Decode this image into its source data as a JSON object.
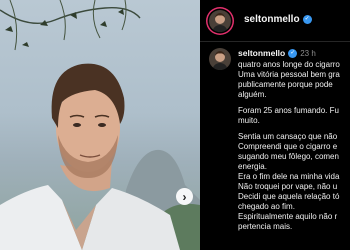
{
  "post": {
    "carousel_next_icon": "chevron-right-icon",
    "username": "seltonmello",
    "verified_icon": "verified-badge-icon",
    "time": "23 h",
    "caption_lines": [
      "quatro anos longe do cigarro",
      "Uma vitória pessoal bem gra",
      "publicamente porque pode",
      "alguém.",
      "Foram 25 anos fumando. Fu",
      "muito.",
      "Sentia um cansaço que não",
      "Compreendi que o cigarro e",
      "sugando meu fôlego, comen",
      "energia.",
      "Era o fim dele na minha vida",
      "Não troquei por vape, não u",
      "Decidi que aquela relação tó",
      "chegado ao fim.",
      "Espiritualmente aquilo não r",
      "pertencia mais."
    ]
  },
  "colors": {
    "background": "#000000",
    "text": "#f0f0f0",
    "muted": "#8e8e8e",
    "verified": "#3897f0",
    "story_ring": "#e1306c"
  }
}
